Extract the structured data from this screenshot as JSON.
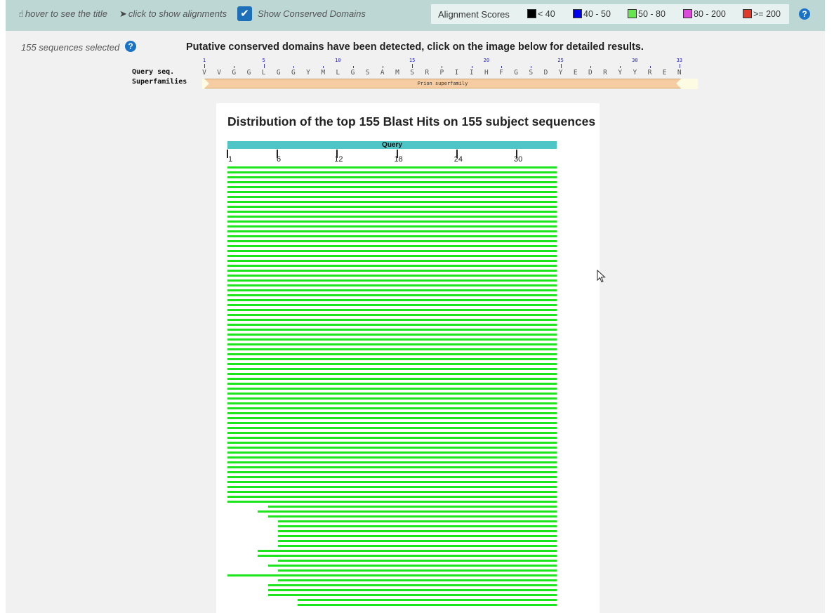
{
  "toolbar": {
    "hover_hint": "hover to see the title",
    "click_hint": "click to show alignments",
    "checkbox_label": "Show Conserved Domains",
    "checkbox_checked": true
  },
  "legend": {
    "title": "Alignment Scores",
    "items": [
      {
        "label": "< 40",
        "color": "#000000"
      },
      {
        "label": "40 - 50",
        "color": "#0000ee"
      },
      {
        "label": "50 - 80",
        "color": "#66e64d"
      },
      {
        "label": "80 - 200",
        "color": "#d94bd9"
      },
      {
        "label": ">= 200",
        "color": "#e03b2a"
      }
    ]
  },
  "selection": {
    "text": "155 sequences selected"
  },
  "cdd": {
    "heading": "Putative conserved domains have been detected, click on the image below for detailed results.",
    "query_label": "Query seq.",
    "superfamily_label": "Superfamilies",
    "position_numbers": [
      "1",
      "5",
      "10",
      "15",
      "20",
      "25",
      "30",
      "33"
    ],
    "sequence": [
      "V",
      "V",
      "G",
      "G",
      "L",
      "G",
      "G",
      "Y",
      "M",
      "L",
      "G",
      "S",
      "A",
      "M",
      "S",
      "R",
      "P",
      "I",
      "I",
      "H",
      "F",
      "G",
      "S",
      "D",
      "Y",
      "E",
      "D",
      "R",
      "Y",
      "Y",
      "R",
      "E",
      "N"
    ],
    "superfamily_name": "Prion superfamily"
  },
  "graphic": {
    "title": "Distribution of the top 155 Blast Hits on 155 subject sequences",
    "query_label": "Query",
    "axis_ticks": [
      "1",
      "6",
      "12",
      "18",
      "24",
      "30"
    ],
    "hit_color": "#1de51d"
  }
}
